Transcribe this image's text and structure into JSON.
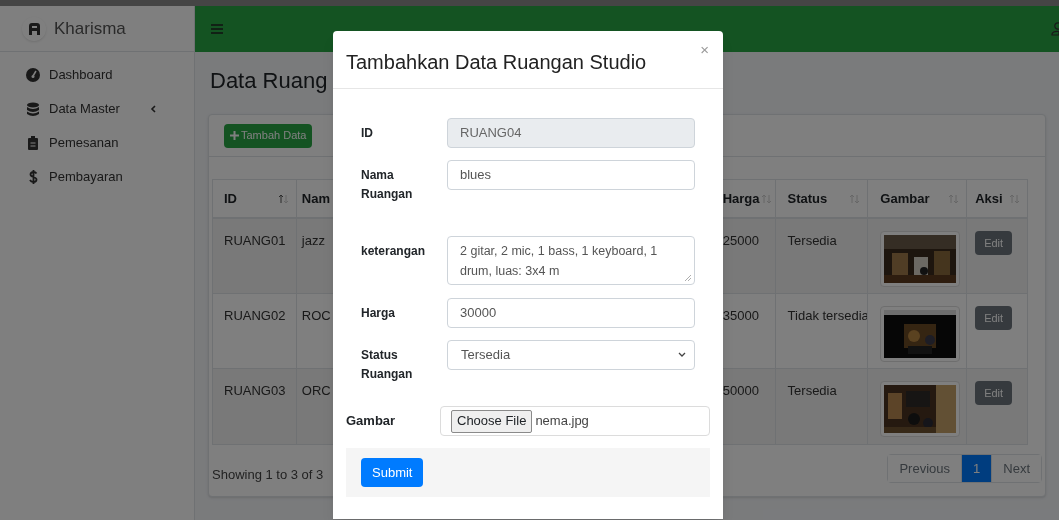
{
  "sidebar": {
    "brand": "Kharisma",
    "items": [
      {
        "label": "Dashboard",
        "has_submenu": false
      },
      {
        "label": "Data Master",
        "has_submenu": true
      },
      {
        "label": "Pemesanan",
        "has_submenu": false
      },
      {
        "label": "Pembayaran",
        "has_submenu": false
      }
    ]
  },
  "page": {
    "title": "Data Ruang",
    "add_button": "Tambah Data"
  },
  "table": {
    "columns": [
      {
        "label": "ID",
        "sorted": true
      },
      {
        "label": "Nam"
      },
      {
        "label": "Harga",
        "sorted": false
      },
      {
        "label": "Status",
        "sorted": false
      },
      {
        "label": "Gambar",
        "sorted": false
      },
      {
        "label": "Aksi",
        "sorted": false
      }
    ],
    "rows": [
      {
        "cells": [
          "RUANG01",
          "jazz",
          "25000",
          "Tersedia"
        ],
        "gambar": {
          "kind": "picture"
        },
        "action": "Edit"
      },
      {
        "cells": [
          "RUANG02",
          "ROC",
          "35000",
          "Tidak tersedia"
        ],
        "gambar": {
          "kind": "picture"
        },
        "action": "Edit"
      },
      {
        "cells": [
          "RUANG03",
          "ORC",
          "50000",
          "Tersedia"
        ],
        "gambar": {
          "kind": "picture"
        },
        "action": "Edit"
      }
    ],
    "info": "Showing 1 to 3 of 3",
    "pagination": [
      {
        "label": "Previous",
        "selected": false
      },
      {
        "label": "1",
        "selected": true
      },
      {
        "label": "Next",
        "selected": false
      }
    ]
  },
  "modal": {
    "title": "Tambahkan Data Ruangan Studio",
    "close": "×",
    "fields": [
      {
        "kind": "text",
        "label": "ID",
        "value": "RUANG04",
        "disabled": true
      },
      {
        "kind": "text",
        "label": "Nama Ruangan",
        "value": "blues",
        "disabled": false
      },
      {
        "kind": "textarea",
        "label": "keterangan",
        "value": "2 gitar,  2 mic, 1 bass, 1 keyboard, 1 drum, luas: 3x4 m"
      },
      {
        "kind": "text",
        "label": "Harga",
        "value": "30000",
        "disabled": false
      },
      {
        "kind": "select",
        "label": "Status Ruangan",
        "value": "Tersedia"
      }
    ],
    "file": {
      "label": "Gambar",
      "button": "Choose File",
      "filename": "nema.jpg"
    },
    "submit": "Submit"
  }
}
